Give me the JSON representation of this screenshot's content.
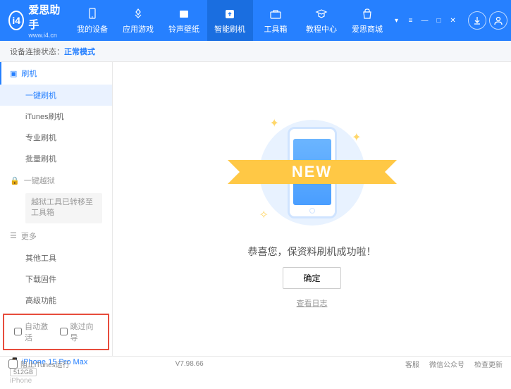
{
  "header": {
    "logo_text": "爱思助手",
    "logo_sub": "www.i4.cn",
    "nav": [
      {
        "label": "我的设备"
      },
      {
        "label": "应用游戏"
      },
      {
        "label": "铃声壁纸"
      },
      {
        "label": "智能刷机"
      },
      {
        "label": "工具箱"
      },
      {
        "label": "教程中心"
      },
      {
        "label": "爱思商城"
      }
    ]
  },
  "status": {
    "label": "设备连接状态：",
    "value": "正常模式"
  },
  "sidebar": {
    "section_flash": "刷机",
    "items_flash": [
      "一键刷机",
      "iTunes刷机",
      "专业刷机",
      "批量刷机"
    ],
    "section_jailbreak": "一键越狱",
    "jailbreak_note": "越狱工具已转移至工具箱",
    "section_more": "更多",
    "items_more": [
      "其他工具",
      "下载固件",
      "高级功能"
    ],
    "checkbox_auto": "自动激活",
    "checkbox_skip": "跳过向导",
    "device_name": "iPhone 15 Pro Max",
    "device_storage": "512GB",
    "device_type": "iPhone"
  },
  "main": {
    "ribbon": "NEW",
    "success": "恭喜您，保资料刷机成功啦！",
    "ok": "确定",
    "log_link": "查看日志"
  },
  "footer": {
    "block_itunes": "阻止iTunes运行",
    "version": "V7.98.66",
    "links": [
      "客服",
      "微信公众号",
      "检查更新"
    ]
  }
}
